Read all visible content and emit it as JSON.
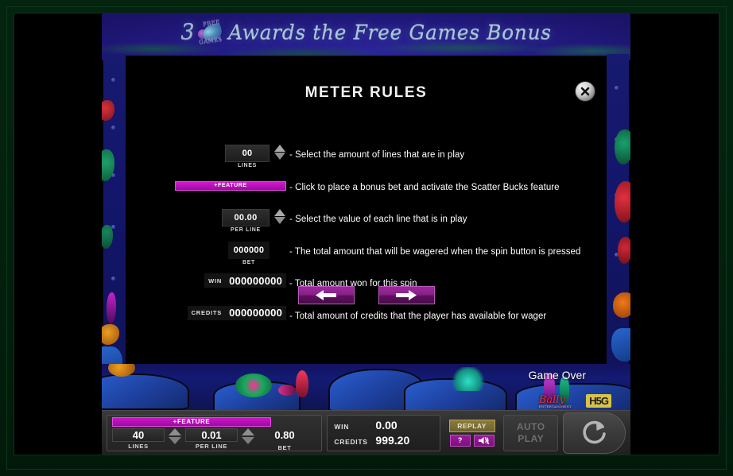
{
  "banner": {
    "lead_number": "3",
    "shell_top": "FREE",
    "shell_bottom": "GAMES",
    "text": "Awards the Free Games Bonus"
  },
  "dialog": {
    "title": "METER RULES",
    "close_icon": "close-circle-icon",
    "rules": [
      {
        "widget": "stepper",
        "value": "00",
        "label": "LINES",
        "description": "- Select the amount of lines that are in play"
      },
      {
        "widget": "feature",
        "value": "+FEATURE",
        "label": "",
        "description": "- Click to place a bonus bet and activate the Scatter Bucks feature"
      },
      {
        "widget": "stepper",
        "value": "00.00",
        "label": "PER LINE",
        "description": "- Select the value of each line that is in play"
      },
      {
        "widget": "plain",
        "value": "000000",
        "label": "BET",
        "description": "- The total amount that will be wagered when the spin button is pressed"
      },
      {
        "widget": "labelvalue",
        "value": "000000000",
        "label": "WIN",
        "description": "- Total amount won for this spin"
      },
      {
        "widget": "labelvalue",
        "value": "000000000",
        "label": "CREDITS",
        "description": "- Total amount of credits that the player has available for wager"
      }
    ],
    "nav": {
      "prev_icon": "arrow-left-icon",
      "next_icon": "arrow-right-icon"
    }
  },
  "reef": {
    "game_status": "Game Over",
    "logo_primary": "Bally",
    "logo_primary_sub": "ENTERTAINMENT",
    "logo_secondary": "H5G"
  },
  "deck": {
    "feature_label": "+FEATURE",
    "lines": {
      "value": "40",
      "label": "LINES"
    },
    "per_line": {
      "value": "0.01",
      "label": "PER LINE"
    },
    "bet": {
      "value": "0.80",
      "label": "BET"
    },
    "win": {
      "label": "WIN",
      "value": "0.00"
    },
    "credits": {
      "label": "CREDITS",
      "value": "999.20"
    },
    "replay_label": "REPLAY",
    "help_label": "?",
    "sound_icon": "speaker-muted-icon",
    "autoplay_line1": "AUTO",
    "autoplay_line2": "PLAY",
    "spin_icon": "spin-refresh-icon"
  },
  "colors": {
    "feature_magenta": "#cc14cc",
    "nav_purple": "#8a1f8a",
    "banner_blue": "#241c85",
    "frame_green": "#04240f",
    "replay_olive": "#8a7c3a"
  }
}
